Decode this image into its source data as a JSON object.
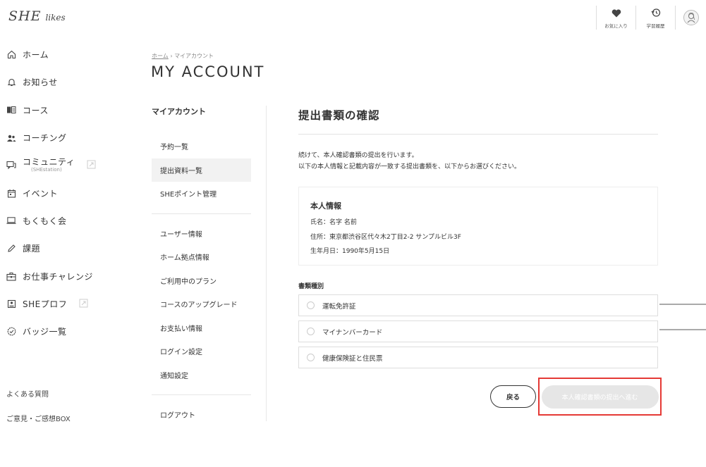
{
  "logo": {
    "she": "SHE",
    "likes": "likes"
  },
  "header": {
    "favorites_label": "お気に入り",
    "history_label": "学習履歴"
  },
  "nav": {
    "items": [
      {
        "label": "ホーム",
        "icon": "home-icon"
      },
      {
        "label": "お知らせ",
        "icon": "bell-icon"
      },
      {
        "label": "コース",
        "icon": "book-icon"
      },
      {
        "label": "コーチング",
        "icon": "people-icon"
      },
      {
        "label": "コミュニティ",
        "sub": "(SHEstation)",
        "icon": "chat-icon"
      },
      {
        "label": "イベント",
        "icon": "calendar-icon"
      },
      {
        "label": "もくもく会",
        "icon": "laptop-icon"
      },
      {
        "label": "課題",
        "icon": "pencil-icon"
      },
      {
        "label": "お仕事チャレンジ",
        "icon": "briefcase-icon"
      },
      {
        "label": "SHEプロフ",
        "icon": "profile-card-icon"
      },
      {
        "label": "バッジ一覧",
        "icon": "badge-icon"
      }
    ],
    "faq": "よくある質問",
    "feedback": "ご意見・ご感想BOX"
  },
  "breadcrumb": {
    "home": "ホーム",
    "sep": "›",
    "current": "マイアカウント"
  },
  "page_title": "MY ACCOUNT",
  "submenu": {
    "heading": "マイアカウント",
    "group1": [
      "予約一覧",
      "提出資料一覧",
      "SHEポイント管理"
    ],
    "group2": [
      "ユーザー情報",
      "ホーム拠点情報",
      "ご利用中のプラン",
      "コースのアップグレード",
      "お支払い情報",
      "ログイン設定",
      "通知設定"
    ],
    "logout": "ログアウト"
  },
  "main": {
    "title": "提出書類の確認",
    "intro_line1": "続けて、本人確認書類の提出を行います。",
    "intro_line2": "以下の本人情報と記載内容が一致する提出書類を、以下からお選びください。",
    "info": {
      "title": "本人情報",
      "name": "氏名：名字 名前",
      "address": "住所：東京都渋谷区代々木2丁目2-2 サンプルビル3F",
      "birthday": "生年月日：1990年5月15日"
    },
    "doc_label": "書類種別",
    "options": [
      "運転免許証",
      "マイナンバーカード",
      "健康保険証と住民票"
    ],
    "back_label": "戻る",
    "submit_label": "本人確認書類の提出へ進む"
  },
  "colors": {
    "highlight": "#e53935",
    "disabled_button": "#e6e6e6"
  }
}
